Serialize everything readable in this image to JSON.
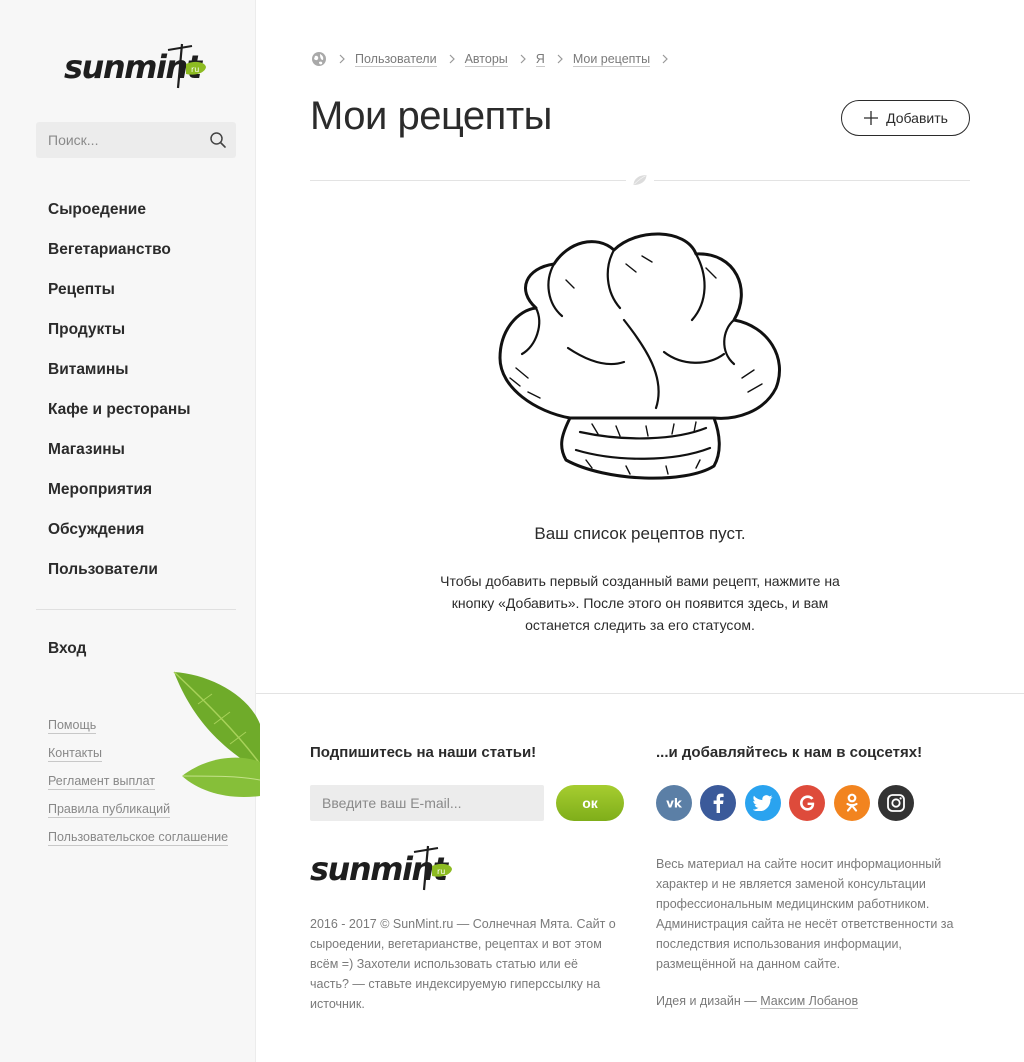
{
  "logo": {
    "text": "sunmint",
    "badge": "ru"
  },
  "search": {
    "placeholder": "Поиск..."
  },
  "nav": {
    "items": [
      {
        "label": "Сыроедение"
      },
      {
        "label": "Вегетарианство"
      },
      {
        "label": "Рецепты"
      },
      {
        "label": "Продукты"
      },
      {
        "label": "Витамины"
      },
      {
        "label": "Кафе и рестораны"
      },
      {
        "label": "Магазины"
      },
      {
        "label": "Мероприятия"
      },
      {
        "label": "Обсуждения"
      },
      {
        "label": "Пользователи"
      }
    ],
    "login": "Вход"
  },
  "sidebar_links": [
    "Помощь",
    "Контакты",
    "Регламент выплат",
    "Правила публикаций",
    "Пользовательское соглашение"
  ],
  "breadcrumb": [
    "Пользователи",
    "Авторы",
    "Я",
    "Мои рецепты"
  ],
  "main": {
    "title": "Мои рецепты",
    "add_label": "Добавить",
    "empty_title": "Ваш список рецептов пуст.",
    "empty_text": "Чтобы добавить первый созданный вами рецепт, нажмите на кнопку «Добавить». После этого он появится здесь, и вам останется следить за его статусом."
  },
  "footer": {
    "subscribe_title": "Подпишитесь на наши статьи!",
    "email_placeholder": "Введите ваш E-mail...",
    "ok_label": "ок",
    "social_title": "...и добавляйтесь к нам в соцсетях!",
    "social": [
      {
        "icon": "vk-icon",
        "color": "#5b7fa6"
      },
      {
        "icon": "facebook-icon",
        "color": "#3b5a9a"
      },
      {
        "icon": "twitter-icon",
        "color": "#2aa3ef"
      },
      {
        "icon": "google-icon",
        "color": "#de4b3b"
      },
      {
        "icon": "odnoklassniki-icon",
        "color": "#f2841f"
      },
      {
        "icon": "instagram-icon",
        "color": "#333333"
      }
    ],
    "copyright": "2016 - 2017 © SunMint.ru — Солнечная Мята. Сайт о сыроедении, вегетарианстве, рецептах и вот этом всём =) Захотели использовать статью или её часть? — ставьте индексируемую гиперссылку на источник.",
    "disclaimer": "Весь материал на сайте носит информационный характер и не является заменой консультации профессиональным медицинским работником. Администрация сайта не несёт ответственности за последствия использования информации, размещённой на данном сайте.",
    "credits_prefix": "Идея и дизайн — ",
    "credits_name": "Максим Лобанов"
  },
  "colors": {
    "accent_green": "#8dbb22",
    "text": "#2b2b2b",
    "muted": "#7a7a7a",
    "sidebar_bg": "#f7f7f7"
  }
}
